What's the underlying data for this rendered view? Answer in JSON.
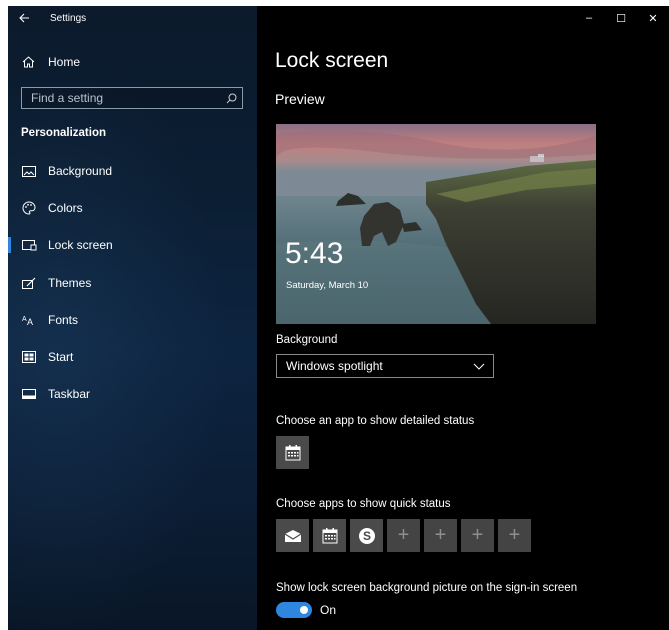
{
  "window": {
    "app_title": "Settings",
    "controls": {
      "minimize": "–",
      "maximize": "☐",
      "close": "✕"
    }
  },
  "sidebar": {
    "home_label": "Home",
    "search": {
      "placeholder": "Find a setting"
    },
    "section_header": "Personalization",
    "items": [
      {
        "label": "Background",
        "icon": "image-icon"
      },
      {
        "label": "Colors",
        "icon": "palette-icon"
      },
      {
        "label": "Lock screen",
        "icon": "lock-screen-icon",
        "selected": true
      },
      {
        "label": "Themes",
        "icon": "themes-icon"
      },
      {
        "label": "Fonts",
        "icon": "fonts-icon"
      },
      {
        "label": "Start",
        "icon": "start-icon"
      },
      {
        "label": "Taskbar",
        "icon": "taskbar-icon"
      }
    ]
  },
  "main": {
    "page_title": "Lock screen",
    "preview_heading": "Preview",
    "preview": {
      "time": "5:43",
      "date": "Saturday, March 10"
    },
    "background_label": "Background",
    "background_value": "Windows spotlight",
    "detailed_status_label": "Choose an app to show detailed status",
    "detailed_status_app": "calendar-icon",
    "quick_status_label": "Choose apps to show quick status",
    "quick_status_apps": [
      "mail-icon",
      "calendar-icon",
      "skype-icon",
      "add-icon",
      "add-icon",
      "add-icon",
      "add-icon"
    ],
    "plus_glyph": "+",
    "signin_label": "Show lock screen background picture on the sign-in screen",
    "signin_toggle": {
      "state": "On",
      "on": true
    }
  },
  "colors": {
    "accent": "#2f86df",
    "sidebar_bg": "#0b1e33",
    "main_bg": "#000000",
    "tile_bg": "#4a4a4a"
  }
}
